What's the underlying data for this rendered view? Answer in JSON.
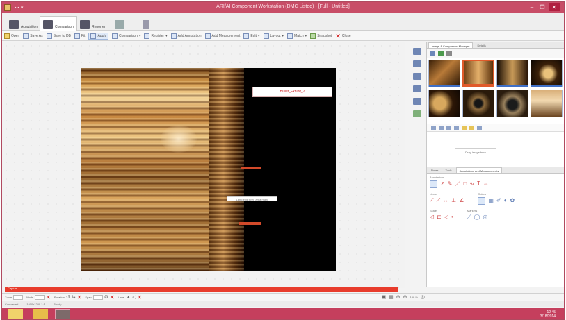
{
  "window": {
    "title": "ARI/AI Component Workstation (DMC Listed) - [Full - Untitled]",
    "controls": [
      "–",
      "❐",
      "✕"
    ]
  },
  "ribbon_tabs": [
    {
      "label": "Acquisition"
    },
    {
      "label": "Comparison"
    },
    {
      "label": "Reporter"
    },
    {
      "label": ""
    },
    {
      "label": ""
    }
  ],
  "toolbar": {
    "items": [
      {
        "label": "Open"
      },
      {
        "label": "Save As"
      },
      {
        "label": "Save to DB"
      },
      {
        "label": "Fit"
      },
      {
        "label": "Apply"
      },
      {
        "label": "Comparison"
      },
      {
        "label": "Register"
      },
      {
        "label": "Add Annotation"
      },
      {
        "label": "Add Measurement"
      },
      {
        "label": "Edit"
      },
      {
        "label": "Layout"
      },
      {
        "label": "Match"
      },
      {
        "label": "Snapshot"
      },
      {
        "label": "Close"
      }
    ]
  },
  "image_panel": {
    "title_label": "Bullet_Exhibit_2",
    "small_label": "Land engraved area mark"
  },
  "right_panel": {
    "tabs": [
      "Image & Comparison Manager",
      "Details"
    ],
    "drag_hint": "Drag image here",
    "annotations_tabs": [
      "Notes",
      "Tools",
      "Annotations and Measurements"
    ],
    "groups": {
      "annotations": "Annotations",
      "lines": "Lines",
      "colors": "Colors",
      "scale": "Scale",
      "markers": "Markers"
    }
  },
  "bottom": {
    "red_label": "Capture",
    "fields": [
      "Zoom",
      "Mode",
      "Rotation",
      "Span",
      "Level"
    ],
    "zoom_value": "100 %"
  },
  "statusbar": [
    "Connected",
    "1600x1200  1:1",
    "Ready"
  ],
  "taskbar": {
    "clock_time": "12:45",
    "clock_date": "3/18/2014"
  }
}
